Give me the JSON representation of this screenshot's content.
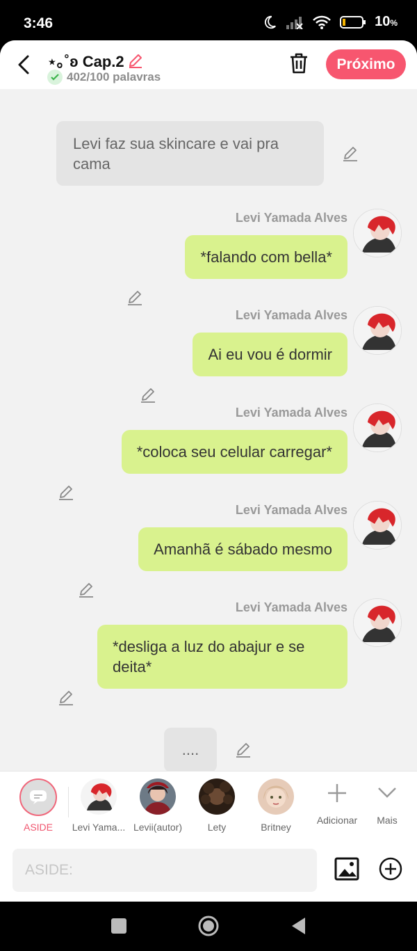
{
  "status": {
    "time": "3:46",
    "battery": "10",
    "battery_unit": "%"
  },
  "header": {
    "title": "⋆｡˚ʚ Cap.2",
    "wordcount": "402/100 palavras",
    "next_label": "Próximo"
  },
  "messages": [
    {
      "type": "narration",
      "text": "Levi faz sua skincare e vai pra cama"
    },
    {
      "type": "character",
      "name": "Levi Yamada Alves",
      "text": "*falando com bella*"
    },
    {
      "type": "character",
      "name": "Levi Yamada Alves",
      "text": "Ai eu vou é dormir"
    },
    {
      "type": "character",
      "name": "Levi Yamada Alves",
      "text": "*coloca seu celular carregar*"
    },
    {
      "type": "character",
      "name": "Levi Yamada Alves",
      "text": "Amanhã é sábado mesmo"
    },
    {
      "type": "character",
      "name": "Levi Yamada Alves",
      "text": "*desliga a luz do abajur e se deita*"
    },
    {
      "type": "narration",
      "text": "...."
    }
  ],
  "characters": [
    {
      "label": "ASIDE",
      "selected": true
    },
    {
      "label": "Levi Yama..."
    },
    {
      "label": "Levii(autor)"
    },
    {
      "label": "Lety"
    },
    {
      "label": "Britney"
    },
    {
      "label": "Adicionar"
    },
    {
      "label": "Mais"
    }
  ],
  "input": {
    "placeholder": "ASIDE:"
  },
  "colors": {
    "accent": "#f7566f",
    "bubble": "#d9f28e",
    "narration_bg": "#e4e4e4"
  }
}
